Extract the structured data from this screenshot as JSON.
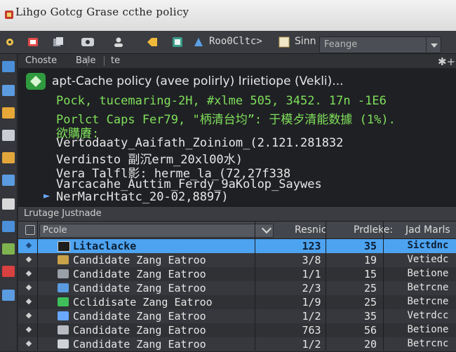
{
  "window": {
    "title": "Lihgo  Gotcg  Grase  ccthe  policy"
  },
  "toolbar": {
    "address_label": "Roo0Cltc>",
    "sinn_label": "Sinn",
    "dropdown_value": "Feange"
  },
  "breadcrumb": {
    "item1": "Choste",
    "item2": "Bale",
    "item3": "te"
  },
  "terminal": {
    "header": "apt-Cache policy  (avee polirly)  Iriietiope (Vekli)...",
    "lines": [
      {
        "text": "Pock, tucemaring-2H, #xlme 505, 3452. 17n -1E6",
        "color": "green"
      },
      {
        "text": "Porlct Caps Fer79, \"柄清台均”: 于模歺清能数據 (1%).",
        "color": "green"
      },
      {
        "text": "欲購賡:",
        "color": "green"
      },
      {
        "text": "Vertodaaty_Aaifath_Zoiniom_(2.121.281832",
        "color": "white"
      },
      {
        "text": "Verdinsto 副沉erm_20xl00水)",
        "color": "white"
      },
      {
        "text": "Vera Talfl影: herme_la_(72,27f338",
        "color": "white"
      },
      {
        "text": "Varcacahe_Auttim_Ferdy_9aKolop_Saywes",
        "color": "white"
      },
      {
        "text": "NerMarcHtatc_20-02,8897)",
        "color": "white"
      }
    ]
  },
  "panel": {
    "title": "Lrutage  Justnade"
  },
  "table": {
    "filter_placeholder": "Pcole",
    "headers": {
      "col1": "Resnic",
      "col2": "Prdleke:",
      "col3": "Jad Marls"
    },
    "rows": [
      {
        "name": "Litaclacke",
        "c1": "123",
        "c2": "35",
        "c3": "Sictdnc"
      },
      {
        "name": "Candidate Zang Eatroo",
        "c1": "3/8",
        "c2": "19",
        "c3": "Vetiedc"
      },
      {
        "name": "Candidate Zang Eatroo",
        "c1": "1/1",
        "c2": "15",
        "c3": "Betione"
      },
      {
        "name": "Candidate Zang Eatroo",
        "c1": "2/3",
        "c2": "25",
        "c3": "Betrcne"
      },
      {
        "name": "Cclidisate Zang Eatroo",
        "c1": "1/9",
        "c2": "25",
        "c3": "Betrcne"
      },
      {
        "name": "Candidate Zang Eatroo",
        "c1": "1/2",
        "c2": "35",
        "c3": "Vetrdcc"
      },
      {
        "name": "Candidate Zang Eatroo",
        "c1": "763",
        "c2": "56",
        "c3": "Betione"
      },
      {
        "name": "Candidate Zang Eatroo",
        "c1": "1/2",
        "c2": "20",
        "c3": "Betrcnc"
      }
    ]
  }
}
